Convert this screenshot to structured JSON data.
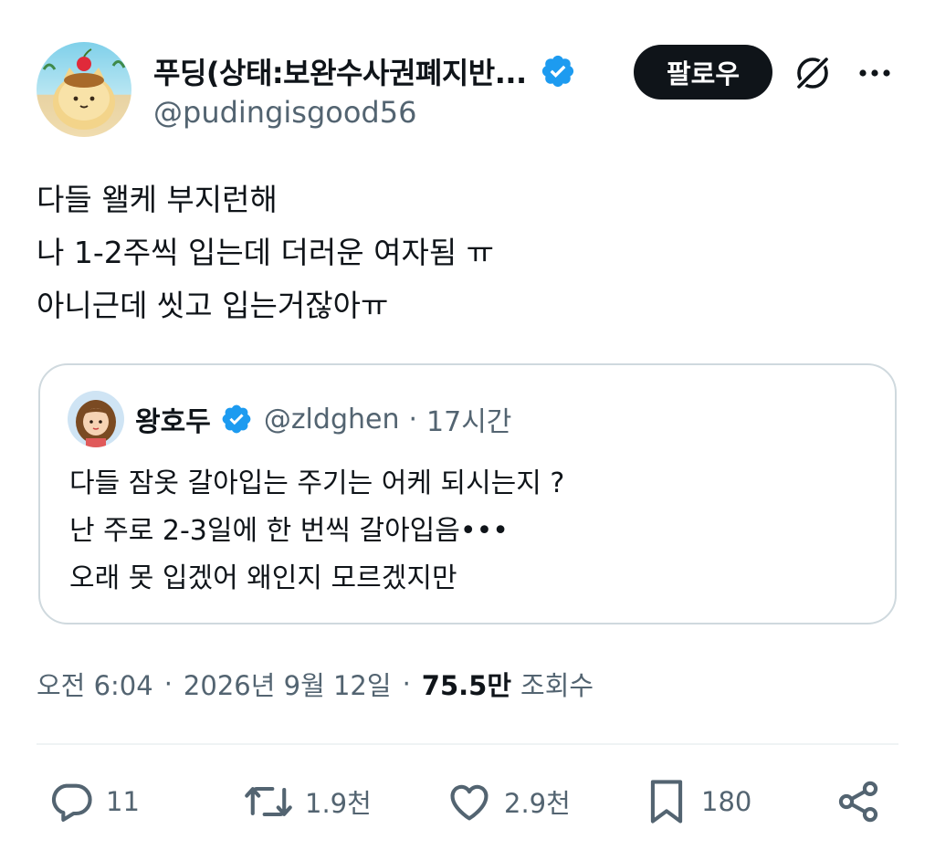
{
  "author": {
    "display_name": "푸딩(상태:보완수사권폐지반...",
    "handle": "@pudingisgood56",
    "verified": true,
    "avatar_icon": "pudding-cat-avatar"
  },
  "header": {
    "follow_label": "팔로우",
    "grok_icon": "grok-icon",
    "more_icon": "more-dots-icon"
  },
  "tweet": {
    "lines": [
      "다들 왤케 부지런해",
      "나 1-2주씩 입는데 더러운 여자됨 ㅠ",
      "아니근데 씻고 입는거잖아ㅠ"
    ]
  },
  "quote": {
    "display_name": "왕호두",
    "handle": "@zldghen",
    "separator": "·",
    "time": "17시간",
    "verified": true,
    "lines": [
      "다들 잠옷 갈아입는 주기는 어케 되시는지 ?",
      "난 주로 2-3일에 한 번씩 갈아입음•••",
      "오래 못 입겠어 왜인지 모르겠지만"
    ]
  },
  "meta": {
    "time": "오전 6:04",
    "separator": "·",
    "date": "2026년 9월 12일",
    "views_count": "75.5만",
    "views_label": "조회수"
  },
  "actions": {
    "reply_count": "11",
    "retweet_count": "1.9천",
    "like_count": "2.9천",
    "bookmark_count": "180"
  },
  "colors": {
    "verified_blue": "#1d9bf0",
    "text_primary": "#0f1419",
    "text_secondary": "#536471",
    "border": "#cfd9de"
  }
}
